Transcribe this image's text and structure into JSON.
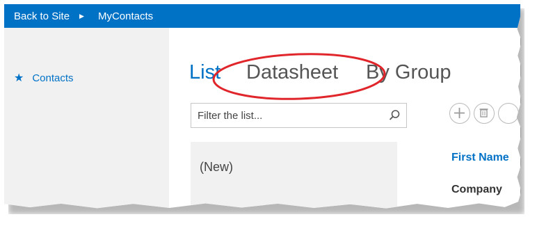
{
  "topbar": {
    "back_label": "Back to Site",
    "arrow_icon": "chevron-right-icon",
    "site_name": "MyContacts",
    "color": "#0072c6"
  },
  "leftnav": {
    "items": [
      {
        "icon": "star-icon",
        "label": "Contacts"
      }
    ]
  },
  "views": {
    "tabs": [
      {
        "label": "List",
        "selected": true
      },
      {
        "label": "Datasheet",
        "selected": false
      },
      {
        "label": "By Group",
        "selected": false
      }
    ],
    "highlight_color": "#e0262b"
  },
  "filter": {
    "placeholder": "Filter the list...",
    "icon": "search-icon"
  },
  "toolbar": {
    "buttons": [
      {
        "icon": "plus-icon"
      },
      {
        "icon": "trash-icon"
      }
    ]
  },
  "list": {
    "new_item": "(New)"
  },
  "details": {
    "first_name_label": "First Name",
    "company_label": "Company"
  }
}
